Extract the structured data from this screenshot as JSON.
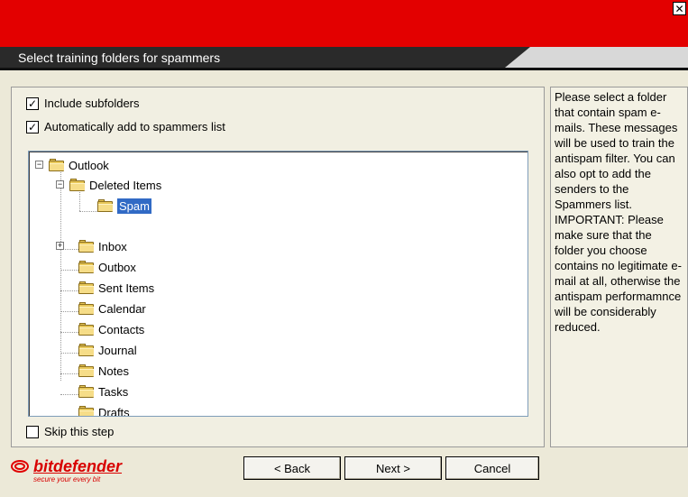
{
  "header": {
    "title": "Select training folders for spammers",
    "close_symbol": "✕"
  },
  "options": {
    "include_subfolders": {
      "label": "Include subfolders",
      "checked": true
    },
    "auto_add": {
      "label": "Automatically add to spammers list",
      "checked": true
    },
    "skip_step": {
      "label": "Skip this step",
      "checked": false
    }
  },
  "tree": {
    "root": "Outlook",
    "deleted_items": "Deleted Items",
    "spam": "Spam",
    "inbox": "Inbox",
    "outbox": "Outbox",
    "sent_items": "Sent Items",
    "calendar": "Calendar",
    "contacts": "Contacts",
    "journal": "Journal",
    "notes": "Notes",
    "tasks": "Tasks",
    "drafts": "Drafts",
    "expanded_symbol": "−",
    "collapsed_symbol": "+"
  },
  "help": {
    "text": "Please select a folder that contain spam e-mails. These messages will be used to train the antispam filter. You can also opt to add the senders to the Spammers list. IMPORTANT: Please make sure that the folder you choose contains no legitimate e-mail at all, otherwise the antispam performamnce will be considerably reduced."
  },
  "buttons": {
    "back": "< Back",
    "next": "Next >",
    "cancel": "Cancel"
  },
  "brand": {
    "name": "bitdefender",
    "tagline": "secure your every bit"
  },
  "colors": {
    "title_bar": "#e30000",
    "selection": "#316ac5",
    "brand": "#d80000"
  }
}
